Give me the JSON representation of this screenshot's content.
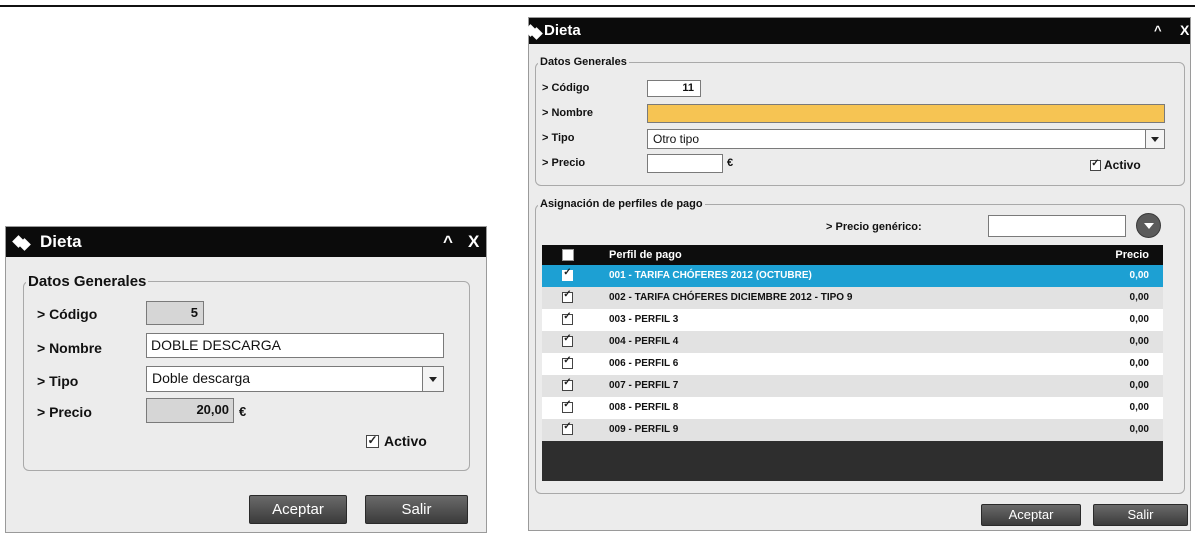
{
  "left_dialog": {
    "title": "Dieta",
    "minimize_glyph": "^",
    "close_glyph": "X",
    "group_title": "Datos Generales",
    "codigo_label": "> Código",
    "codigo_value": "5",
    "nombre_label": "> Nombre",
    "nombre_value": "DOBLE DESCARGA",
    "tipo_label": "> Tipo",
    "tipo_value": "Doble descarga",
    "precio_label": "> Precio",
    "precio_value": "20,00",
    "currency": "€",
    "activo_label": "Activo",
    "activo_checked": true,
    "accept_label": "Aceptar",
    "exit_label": "Salir"
  },
  "right_dialog": {
    "title": "Dieta",
    "minimize_glyph": "^",
    "close_glyph": "X",
    "group_title": "Datos Generales",
    "codigo_label": "> Código",
    "codigo_value": "11",
    "nombre_label": "> Nombre",
    "nombre_value": "",
    "tipo_label": "> Tipo",
    "tipo_value": "Otro tipo",
    "precio_label": "> Precio",
    "precio_value": "",
    "currency": "€",
    "activo_label": "Activo",
    "activo_checked": true,
    "assign_group_title": "Asignación de perfiles de pago",
    "precio_generico_label": "> Precio genérico:",
    "precio_generico_value": "",
    "table": {
      "col_perfil": "Perfil de pago",
      "col_precio": "Precio",
      "rows": [
        {
          "perfil": "001 - TARIFA CHÓFERES 2012 (OCTUBRE)",
          "precio": "0,00",
          "selected": true
        },
        {
          "perfil": "002 - TARIFA CHÓFERES DICIEMBRE 2012 - TIPO 9",
          "precio": "0,00",
          "selected": false
        },
        {
          "perfil": "003 - PERFIL 3",
          "precio": "0,00",
          "selected": false
        },
        {
          "perfil": "004 - PERFIL 4",
          "precio": "0,00",
          "selected": false
        },
        {
          "perfil": "006 - PERFIL 6",
          "precio": "0,00",
          "selected": false
        },
        {
          "perfil": "007 - PERFIL 7",
          "precio": "0,00",
          "selected": false
        },
        {
          "perfil": "008 - PERFIL 8",
          "precio": "0,00",
          "selected": false
        },
        {
          "perfil": "009 - PERFIL 9",
          "precio": "0,00",
          "selected": false
        }
      ]
    },
    "accept_label": "Aceptar",
    "exit_label": "Salir"
  },
  "colors": {
    "titlebar": "#0b0b0b",
    "selected_row": "#1da0d3",
    "highlight_field": "#f6c453",
    "row_even": "#ffffff",
    "row_odd": "#e2e2e2"
  }
}
